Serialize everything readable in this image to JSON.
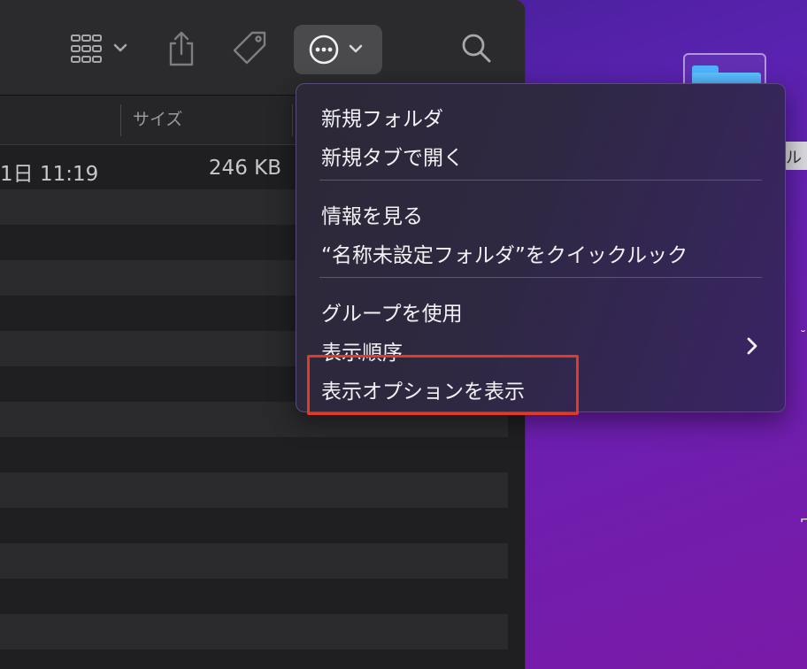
{
  "finder": {
    "toolbar": {
      "view_icon": "grid-view-icon",
      "share_icon": "share-icon",
      "tag_icon": "tag-icon",
      "more_icon": "ellipsis-circle-icon",
      "search_icon": "search-icon"
    },
    "columns": {
      "size_header": "サイズ"
    },
    "rows": [
      {
        "date": "1日 11:19",
        "size": "246 KB"
      }
    ]
  },
  "context_menu": {
    "items": [
      {
        "label": "新規フォルダ"
      },
      {
        "label": "新規タブで開く"
      },
      {
        "label": "情報を見る"
      },
      {
        "label": "“名称未設定フォルダ”をクイックルック"
      },
      {
        "label": "グループを使用"
      },
      {
        "label": "表示順序",
        "has_submenu": true
      },
      {
        "label": "表示オプションを表示",
        "highlighted": true
      }
    ]
  },
  "desktop": {
    "tag_text": "ル"
  },
  "colors": {
    "highlight_border": "#e33a25",
    "desktop_accent": "#6a1fb0"
  }
}
